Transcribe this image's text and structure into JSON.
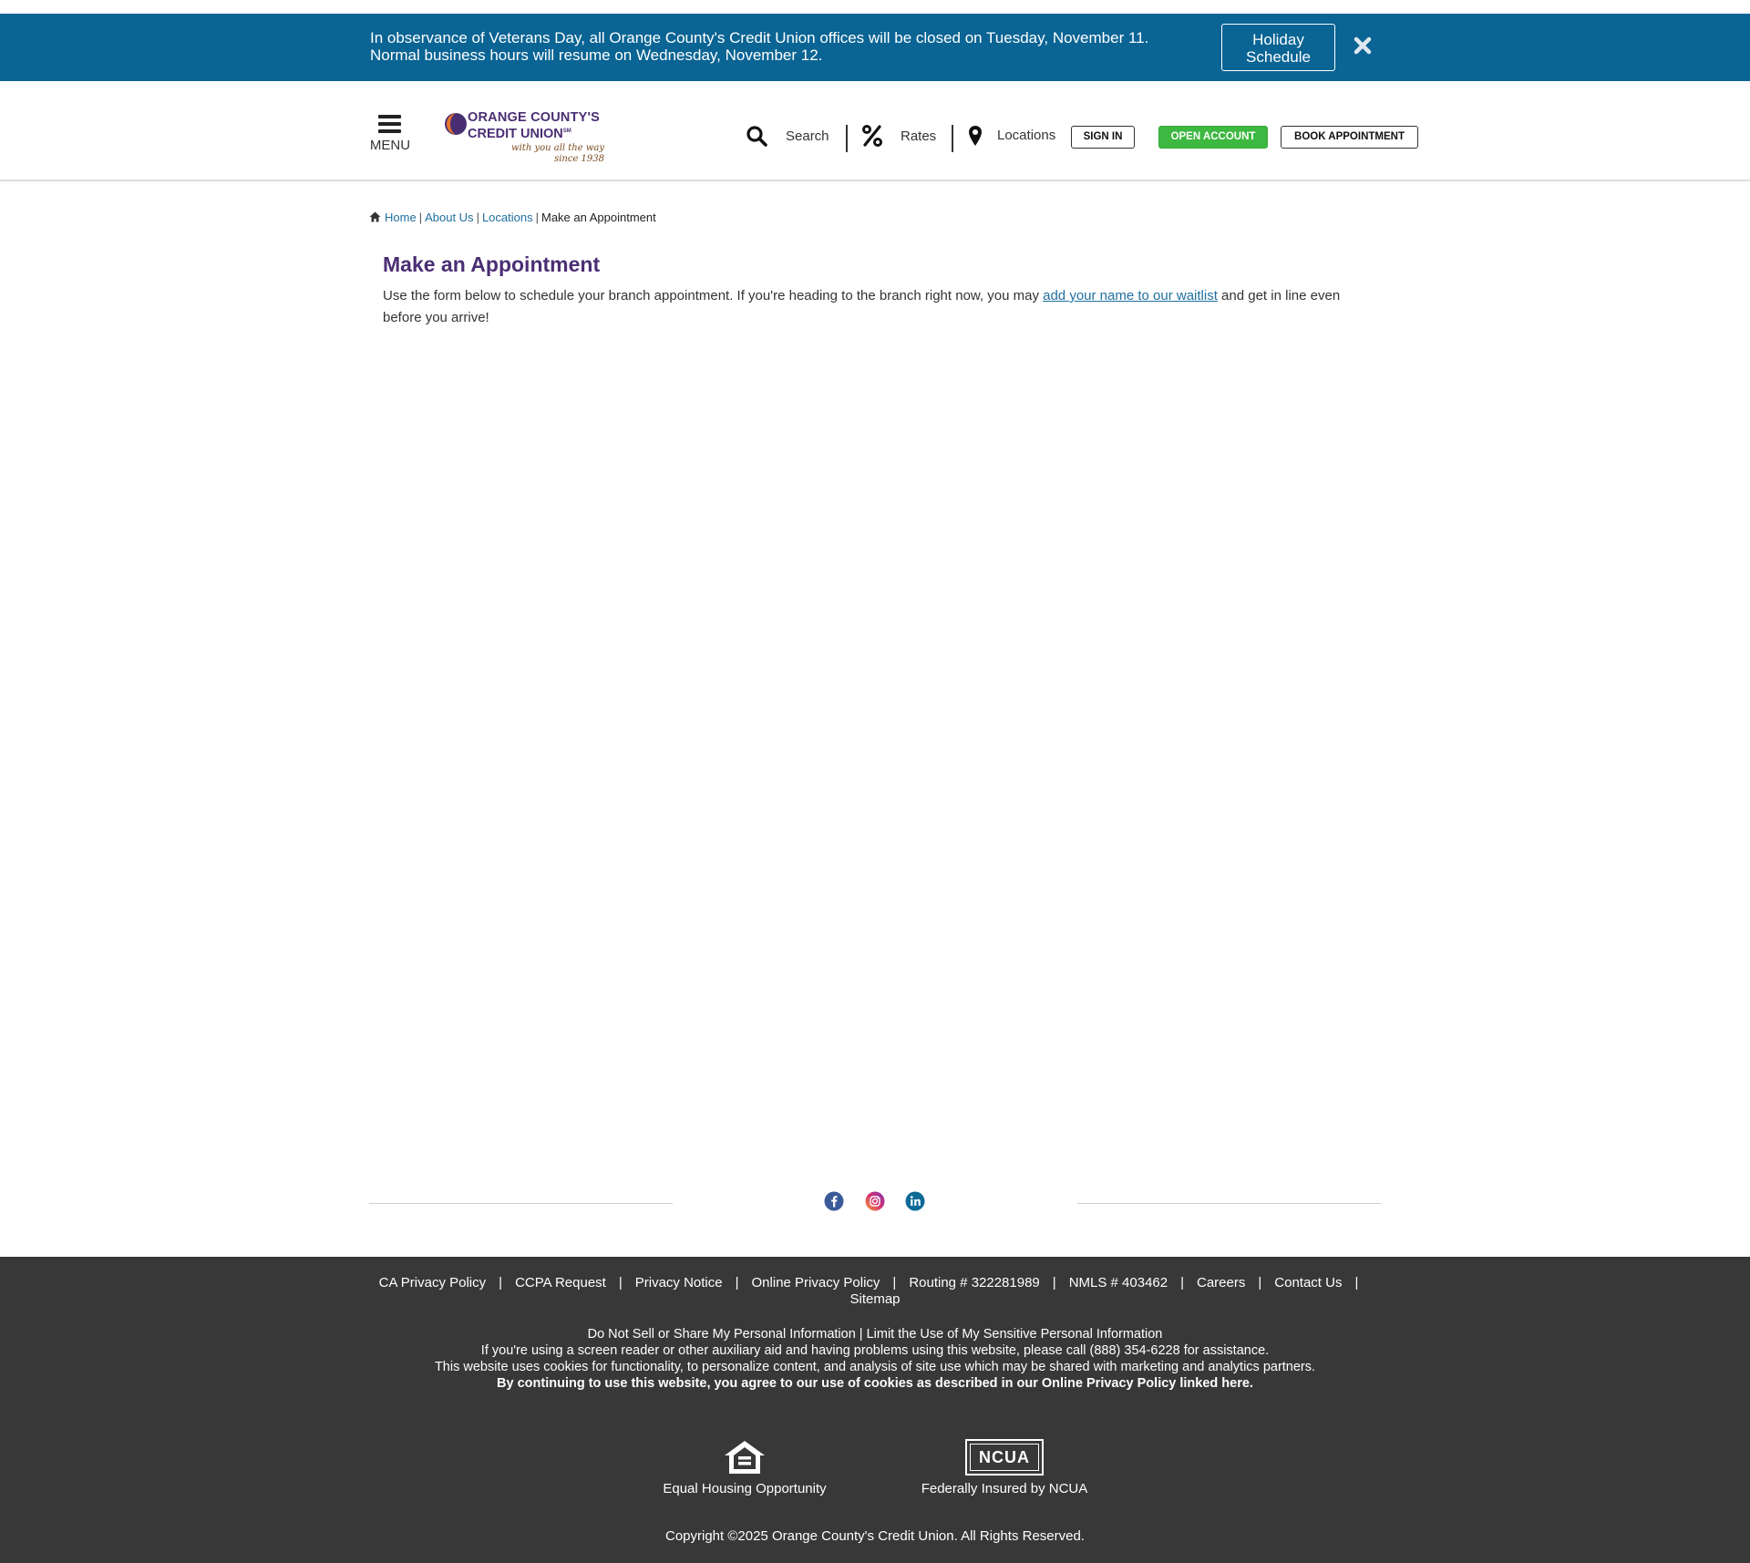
{
  "alert": {
    "line1": "In observance of Veterans Day, all Orange County's Credit Union offices will be closed on Tuesday, November 11.",
    "line2": "Normal business hours will resume on Wednesday, November 12.",
    "button_line1": "Holiday",
    "button_line2": "Schedule",
    "close_icon": "close-icon"
  },
  "header": {
    "menu_label": "MENU",
    "logo": {
      "line1": "ORANGE COUNTY'S",
      "line2": "CREDIT UNION",
      "mark": "SM",
      "tagline1": "with you all the way",
      "tagline2": "since 1938"
    },
    "utility": [
      {
        "icon": "search-icon",
        "label": "Search"
      },
      {
        "icon": "percent-icon",
        "label": "Rates"
      },
      {
        "icon": "map-pin-icon",
        "label": "Locations"
      }
    ],
    "sign_in": "SIGN IN",
    "open_account": "OPEN ACCOUNT",
    "book_appointment": "BOOK APPOINTMENT"
  },
  "breadcrumb": {
    "items": [
      "Home",
      "About Us",
      "Locations"
    ],
    "current": "Make an Appointment"
  },
  "main": {
    "title": "Make an Appointment",
    "intro_before": "Use the form below to schedule your branch appointment. If you're heading to the branch right now, you may ",
    "intro_link": "add your name to our waitlist",
    "intro_after": " and get in line even before you arrive!"
  },
  "social": [
    "facebook-icon",
    "instagram-icon",
    "linkedin-icon"
  ],
  "footer": {
    "links": [
      "CA Privacy Policy",
      "CCPA Request",
      "Privacy Notice",
      "Online Privacy Policy",
      "Routing # 322281989",
      "NMLS # 403462",
      "Careers",
      "Contact Us",
      "Sitemap"
    ],
    "privacy_line": "Do Not Sell or Share My Personal Information | Limit the Use of My Sensitive Personal Information",
    "accessibility_line": "If you're using a screen reader or other auxiliary aid and having problems using this website, please call (888) 354-6228 for assistance.",
    "cookies_line": "This website uses cookies for functionality, to personalize content, and analysis of site use which may be shared with marketing and analytics partners.",
    "consent_line": "By continuing to use this website, you agree to our use of cookies as described in our Online Privacy Policy linked here.",
    "equal_housing": "Equal Housing Opportunity",
    "ncua_badge": "NCUA",
    "ncua_label": "Federally Insured by NCUA",
    "copyright": "Copyright ©2025 Orange County's Credit Union. All Rights Reserved."
  },
  "colors": {
    "banner": "#0a6494",
    "brand_purple": "#4a2e73",
    "link_blue": "#1f6fa0",
    "open_green": "#3db840",
    "footer_bg": "#383838"
  }
}
